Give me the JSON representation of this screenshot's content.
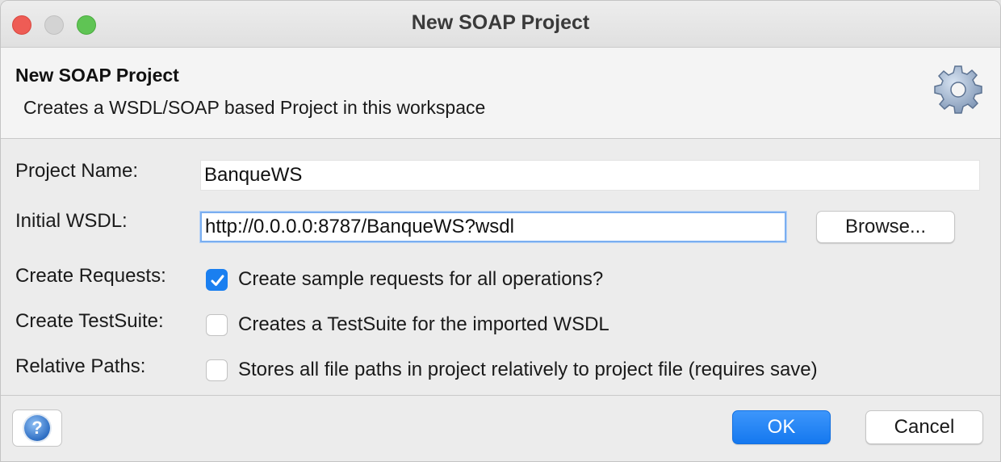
{
  "window": {
    "title": "New SOAP Project"
  },
  "header": {
    "title": "New SOAP Project",
    "description": "Creates a WSDL/SOAP based Project in this workspace",
    "icon": "gear-icon"
  },
  "form": {
    "project_name": {
      "label": "Project Name:",
      "value": "BanqueWS"
    },
    "initial_wsdl": {
      "label": "Initial WSDL:",
      "value": "http://0.0.0.0:8787/BanqueWS?wsdl",
      "browse_label": "Browse..."
    },
    "create_requests": {
      "label": "Create Requests:",
      "text": "Create sample requests for all operations?",
      "checked": true
    },
    "create_testsuite": {
      "label": "Create TestSuite:",
      "text": "Creates a TestSuite for the imported WSDL",
      "checked": false
    },
    "relative_paths": {
      "label": "Relative Paths:",
      "text": "Stores all file paths in project relatively to project file (requires save)",
      "checked": false
    }
  },
  "footer": {
    "help_icon": "help-icon",
    "ok_label": "OK",
    "cancel_label": "Cancel"
  },
  "colors": {
    "accent": "#1a7ff0",
    "close": "#ee5c55",
    "maximize": "#5fc454"
  }
}
